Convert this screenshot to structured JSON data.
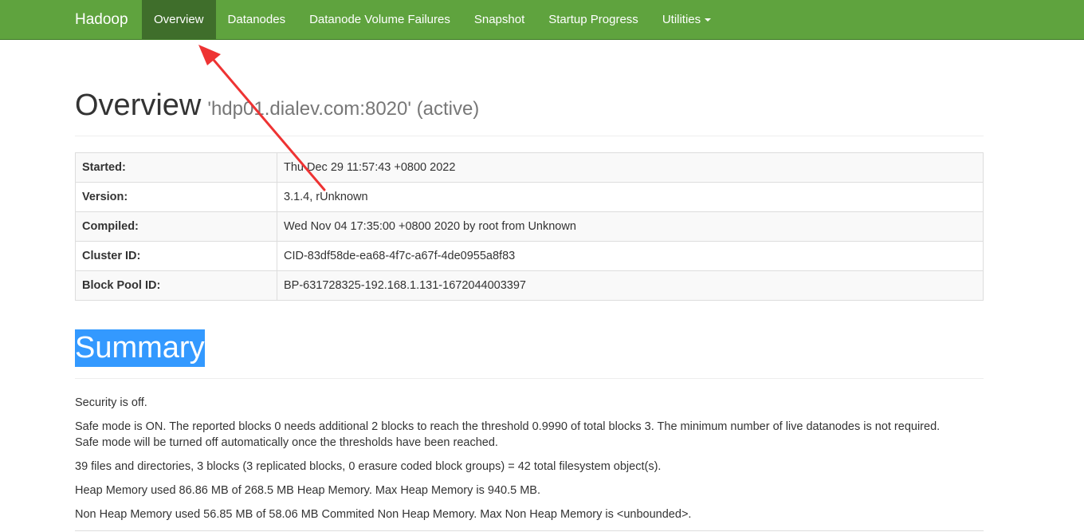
{
  "navbar": {
    "brand": "Hadoop",
    "items": [
      {
        "label": "Overview"
      },
      {
        "label": "Datanodes"
      },
      {
        "label": "Datanode Volume Failures"
      },
      {
        "label": "Snapshot"
      },
      {
        "label": "Startup Progress"
      },
      {
        "label": "Utilities"
      }
    ]
  },
  "overview": {
    "title": "Overview",
    "subtitle": "'hdp01.dialev.com:8020' (active)",
    "rows": [
      {
        "label": "Started:",
        "value": "Thu Dec 29 11:57:43 +0800 2022"
      },
      {
        "label": "Version:",
        "value": "3.1.4, rUnknown"
      },
      {
        "label": "Compiled:",
        "value": "Wed Nov 04 17:35:00 +0800 2020 by root from Unknown"
      },
      {
        "label": "Cluster ID:",
        "value": "CID-83df58de-ea68-4f7c-a67f-4de0955a8f83"
      },
      {
        "label": "Block Pool ID:",
        "value": "BP-631728325-192.168.1.131-1672044003397"
      }
    ]
  },
  "summary": {
    "title": "Summary",
    "security": "Security is off.",
    "safe_mode_1": "Safe mode is ON. The reported blocks 0 needs additional 2 blocks to reach the threshold 0.9990 of total blocks 3. The minimum number of live datanodes is not required.",
    "safe_mode_2": "Safe mode will be turned off automatically once the thresholds have been reached.",
    "files": "39 files and directories, 3 blocks (3 replicated blocks, 0 erasure coded block groups) = 42 total filesystem object(s).",
    "heap": "Heap Memory used 86.86 MB of 268.5 MB Heap Memory. Max Heap Memory is 940.5 MB.",
    "non_heap": "Non Heap Memory used 56.85 MB of 58.06 MB Commited Non Heap Memory. Max Non Heap Memory is <unbounded>."
  },
  "colors": {
    "navbar": "#5fa33e",
    "navbar_active": "#3f6e2b",
    "selection": "#3399ff",
    "annotation_arrow": "#ee3333"
  }
}
